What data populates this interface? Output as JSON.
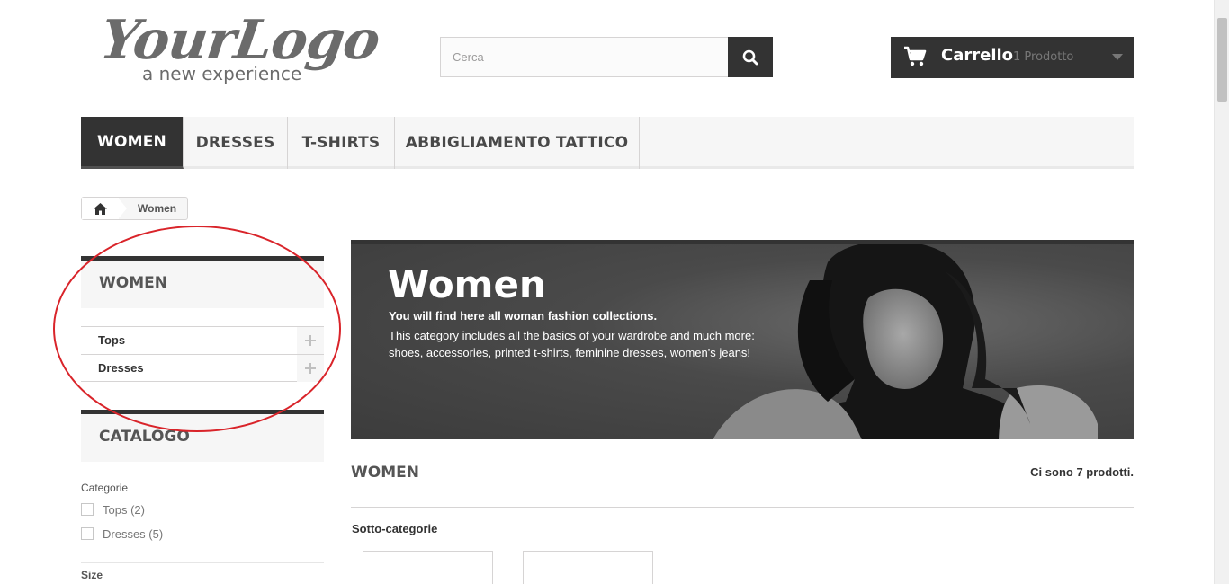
{
  "logo": {
    "script": "YourLogo",
    "tagline": "a new experience"
  },
  "search": {
    "placeholder": "Cerca"
  },
  "cart": {
    "label": "Carrello",
    "quantity": "1 Prodotto"
  },
  "menu": {
    "items": [
      {
        "label": "WOMEN"
      },
      {
        "label": "DRESSES"
      },
      {
        "label": "T-SHIRTS"
      },
      {
        "label": "ABBIGLIAMENTO TATTICO"
      }
    ]
  },
  "breadcrumb": {
    "current": "Women"
  },
  "sidebar": {
    "category_title": "WOMEN",
    "categories": [
      {
        "label": "Tops"
      },
      {
        "label": "Dresses"
      }
    ],
    "catalog_title": "CATALOGO",
    "filters_heading": "Categorie",
    "filters": [
      {
        "label": "Tops (2)"
      },
      {
        "label": "Dresses (5)"
      }
    ],
    "size_heading": "Size"
  },
  "banner": {
    "title": "Women",
    "lead": "You will find here all woman fashion collections.",
    "text": "This category includes all the basics of your wardrobe and much more: shoes, accessories, printed t-shirts, feminine dresses, women's jeans!"
  },
  "main": {
    "heading": "WOMEN",
    "count": "Ci sono 7 prodotti.",
    "subcategories_heading": "Sotto-categorie"
  },
  "colors": {
    "dark": "#333333",
    "annotation": "#d9242a"
  }
}
